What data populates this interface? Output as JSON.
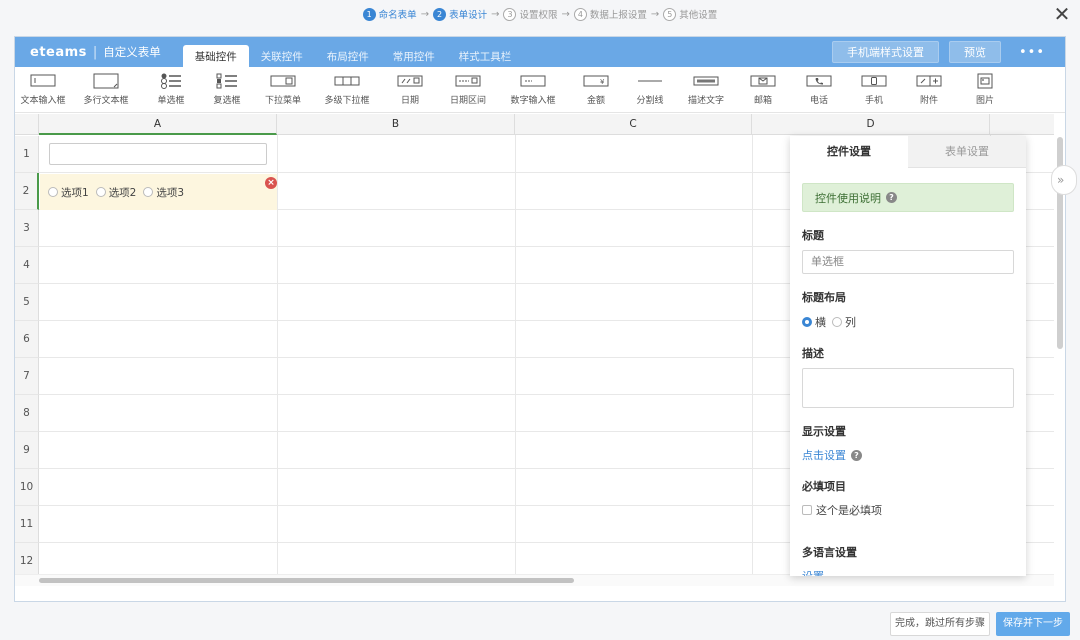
{
  "wizard": {
    "steps": [
      {
        "num": "1",
        "label": "命名表单"
      },
      {
        "num": "2",
        "label": "表单设计"
      },
      {
        "num": "3",
        "label": "设置权限"
      },
      {
        "num": "4",
        "label": "数据上报设置"
      },
      {
        "num": "5",
        "label": "其他设置"
      }
    ],
    "arrow": "→",
    "close": "✕"
  },
  "header": {
    "logo": "eteams",
    "separator": "|",
    "subtitle": "自定义表单",
    "tabs": [
      "基础控件",
      "关联控件",
      "布局控件",
      "常用控件",
      "样式工具栏"
    ],
    "mobile_style_button": "手机端样式设置",
    "preview_button": "预览",
    "more": "•••"
  },
  "toolbar": {
    "items": [
      {
        "label": "文本输入框",
        "icon": "text-input-icon"
      },
      {
        "label": "多行文本框",
        "icon": "textarea-icon"
      },
      {
        "label": "单选框",
        "icon": "radio-icon"
      },
      {
        "label": "复选框",
        "icon": "checkbox-icon"
      },
      {
        "label": "下拉菜单",
        "icon": "dropdown-icon"
      },
      {
        "label": "多级下拉框",
        "icon": "multi-dropdown-icon"
      },
      {
        "label": "日期",
        "icon": "date-icon"
      },
      {
        "label": "日期区间",
        "icon": "date-range-icon"
      },
      {
        "label": "数字输入框",
        "icon": "number-input-icon"
      },
      {
        "label": "金额",
        "icon": "amount-icon"
      },
      {
        "label": "分割线",
        "icon": "divider-icon"
      },
      {
        "label": "描述文字",
        "icon": "description-icon"
      },
      {
        "label": "邮箱",
        "icon": "email-icon"
      },
      {
        "label": "电话",
        "icon": "phone-icon"
      },
      {
        "label": "手机",
        "icon": "mobile-icon"
      },
      {
        "label": "附件",
        "icon": "attachment-icon"
      },
      {
        "label": "图片",
        "icon": "image-icon"
      }
    ]
  },
  "grid": {
    "columns": [
      "A",
      "B",
      "C",
      "D"
    ],
    "rows": [
      "1",
      "2",
      "3",
      "4",
      "5",
      "6",
      "7",
      "8",
      "9",
      "10",
      "11",
      "12"
    ],
    "radio_options": [
      "选项1",
      "选项2",
      "选项3"
    ],
    "collapse": "»"
  },
  "panel": {
    "tabs": [
      "控件设置",
      "表单设置"
    ],
    "hint": "控件使用说明",
    "title_label": "标题",
    "title_value": "单选框",
    "layout_label": "标题布局",
    "layout_options": [
      "横",
      "列"
    ],
    "desc_label": "描述",
    "display_label": "显示设置",
    "display_link": "点击设置",
    "required_label": "必填项目",
    "required_check": "这个是必填项",
    "lang_label": "多语言设置",
    "lang_link": "设置"
  },
  "footer": {
    "skip_button": "完成，跳过所有步骤",
    "next_button": "保存并下一步"
  },
  "colors": {
    "accent": "#6aa8e6",
    "link": "#3a86d4",
    "hint_bg": "#dff0d8"
  }
}
